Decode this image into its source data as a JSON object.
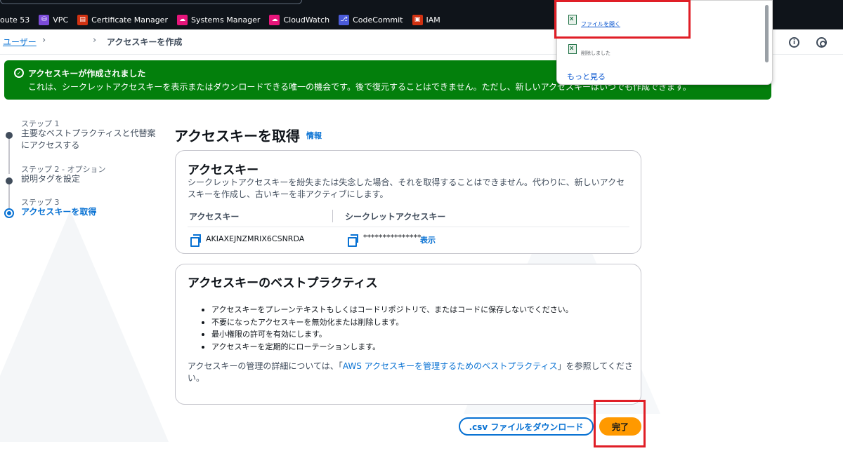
{
  "favorites": [
    {
      "label": "oute 53",
      "icon": "route53-icon",
      "color": ""
    },
    {
      "label": "VPC",
      "icon": "vpc-icon",
      "color": "#7b4bd8"
    },
    {
      "label": "Certificate Manager",
      "icon": "certificate-manager-icon",
      "color": "#d13212"
    },
    {
      "label": "Systems Manager",
      "icon": "systems-manager-icon",
      "color": "#e7157b"
    },
    {
      "label": "CloudWatch",
      "icon": "cloudwatch-icon",
      "color": "#e7157b"
    },
    {
      "label": "CodeCommit",
      "icon": "codecommit-icon",
      "color": "#4a5bd9"
    },
    {
      "label": "IAM",
      "icon": "iam-icon",
      "color": "#d13212"
    }
  ],
  "breadcrumb": {
    "users": "ユーザー",
    "current": "アクセスキーを作成"
  },
  "flash": {
    "title": "アクセスキーが作成されました",
    "message": "これは、シークレットアクセスキーを表示またはダウンロードできる唯一の機会です。後で復元することはできません。ただし、新しいアクセスキーはいつでも作成できます。",
    "color": "#037f0c"
  },
  "steps": [
    {
      "label": "ステップ 1",
      "title": "主要なベストプラクティスと代替案にアクセスする"
    },
    {
      "label": "ステップ 2 - オプション",
      "title": "説明タグを設定"
    },
    {
      "label": "ステップ 3",
      "title": "アクセスキーを取得"
    }
  ],
  "main": {
    "heading": "アクセスキーを取得",
    "info_link": "情報"
  },
  "access_key_panel": {
    "title": "アクセスキー",
    "description": "シークレットアクセスキーを紛失または失念した場合、それを取得することはできません。代わりに、新しいアクセスキーを作成し、古いキーを非アクティブにします。",
    "col_access_key": "アクセスキー",
    "col_secret_key": "シークレットアクセスキー",
    "access_key_value": "AKIAXEJNZMRIX6CSNRDA",
    "secret_key_masked": "***************",
    "show_label": "表示"
  },
  "best_practices_panel": {
    "title": "アクセスキーのベストプラクティス",
    "items": [
      "アクセスキーをプレーンテキストもしくはコードリポジトリで、またはコードに保存しないでください。",
      "不要になったアクセスキーを無効化または削除します。",
      "最小権限の許可を有効にします。",
      "アクセスキーを定期的にローテーションします。"
    ],
    "note_prefix": "アクセスキーの管理の詳細については、「",
    "note_link": "AWS アクセスキーを管理するためのベストプラクティス",
    "note_suffix": "」を参照してください。"
  },
  "buttons": {
    "download_csv": ".csv ファイルをダウンロード",
    "done": "完了"
  },
  "download_popup": {
    "open_file": "ファイルを開く",
    "removed": "削除しました",
    "more": "もっと見る"
  },
  "colors": {
    "accent": "#0972d3",
    "primary_button": "#ff9900",
    "highlight": "#e01e26"
  }
}
